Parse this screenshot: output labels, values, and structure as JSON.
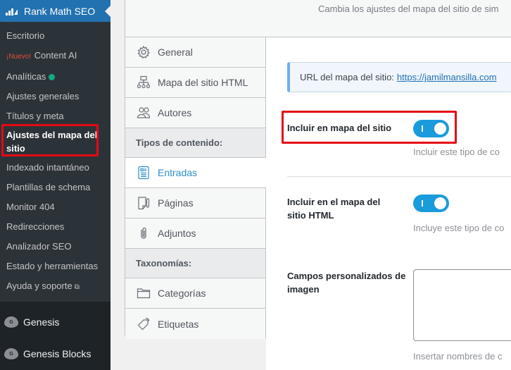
{
  "admin_menu": {
    "active_item": {
      "label": "Rank Math SEO",
      "icon": "rank-math-logo-icon"
    },
    "submenu": [
      {
        "label": "Escritorio"
      },
      {
        "label": "Content AI",
        "badge": "¡Nuevo!"
      },
      {
        "label": "Analíticas",
        "status_dot": "green",
        "status_color": "#10ac84"
      },
      {
        "label": "Ajustes generales"
      },
      {
        "label": "Títulos y meta"
      },
      {
        "label": "Ajustes del mapa del sitio",
        "current": true
      },
      {
        "label": "Indexado intantáneo"
      },
      {
        "label": "Plantillas de schema"
      },
      {
        "label": "Monitor 404"
      },
      {
        "label": "Redirecciones"
      },
      {
        "label": "Analizador SEO"
      },
      {
        "label": "Estado y herramientas"
      },
      {
        "label": "Ayuda y soporte",
        "icon": "external-link-icon"
      }
    ],
    "other_items": [
      {
        "label": "Genesis",
        "icon": "genesis-icon"
      },
      {
        "label": "Genesis Blocks",
        "icon": "genesis-icon"
      }
    ]
  },
  "header": {
    "description": "Cambia los ajustes del mapa del sitio de sim"
  },
  "tabs": {
    "items": [
      {
        "label": "General",
        "icon": "gear-icon"
      },
      {
        "label": "Mapa del sitio HTML",
        "icon": "sitemap-icon"
      },
      {
        "label": "Autores",
        "icon": "users-icon"
      }
    ],
    "section_content_types": "Tipos de contenido:",
    "content_types": [
      {
        "label": "Entradas",
        "icon": "post-icon",
        "active": true
      },
      {
        "label": "Páginas",
        "icon": "page-icon"
      },
      {
        "label": "Adjuntos",
        "icon": "paperclip-icon"
      }
    ],
    "section_taxonomies": "Taxonomías:",
    "taxonomies": [
      {
        "label": "Categorías",
        "icon": "folder-icon"
      },
      {
        "label": "Etiquetas",
        "icon": "tag-icon"
      }
    ]
  },
  "content": {
    "notice_label": "URL del mapa del sitio:",
    "notice_url": "https://jamilmansilla.com",
    "fields": [
      {
        "label": "Incluir en mapa del sitio",
        "type": "toggle",
        "value": true,
        "help": "Incluir este tipo de co"
      },
      {
        "label": "Incluir en el mapa del sitio HTML",
        "type": "toggle",
        "value": true,
        "help": "Incluye este tipo de co"
      },
      {
        "label": "Campos personalizados de imagen",
        "type": "textarea",
        "value": "",
        "help": "Insertar nombres de c"
      }
    ]
  },
  "colors": {
    "accent": "#2271b1",
    "toggle_on": "#1a9bdb",
    "active_tab_text": "#2d8ec4",
    "highlight": "#e50914"
  }
}
